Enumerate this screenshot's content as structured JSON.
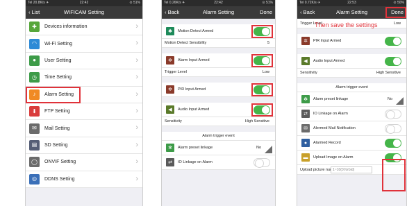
{
  "colors": {
    "accent": "#e0323a",
    "nav": "#3a3a3a",
    "toggle_on": "#45b549",
    "bg": "#efeff4"
  },
  "phone1": {
    "status": {
      "left": "Tel 20.8K/s ✈",
      "center": "22:42",
      "right": "⊙ 51%"
    },
    "nav": {
      "back": "List",
      "title": "WIFICAM Setting"
    },
    "items": [
      {
        "label": "Devices information",
        "icon": "puzzle-icon",
        "color": "#56a63a"
      },
      {
        "label": "Wi-Fi Setting",
        "icon": "wifi-icon",
        "color": "#2d8ad6"
      },
      {
        "label": "User Setting",
        "icon": "user-icon",
        "color": "#3d9b48"
      },
      {
        "label": "Time Setting",
        "icon": "clock-icon",
        "color": "#3d9b48"
      },
      {
        "label": "Alarm Setting",
        "icon": "bell-icon",
        "color": "#f08a24"
      },
      {
        "label": "FTP Setting",
        "icon": "download-icon",
        "color": "#d93c3c"
      },
      {
        "label": "Mail Setting",
        "icon": "mail-icon",
        "color": "#6b6b6b"
      },
      {
        "label": "SD Setting",
        "icon": "sd-card-icon",
        "color": "#555d75"
      },
      {
        "label": "ONVIF Setting",
        "icon": "onvif-icon",
        "color": "#6b6b6b"
      },
      {
        "label": "DDNS Setting",
        "icon": "globe-icon",
        "color": "#3a6fb8"
      }
    ]
  },
  "phone2": {
    "status": {
      "left": "Tel 0.26K/s ✈",
      "center": "22:42",
      "right": "⊙ 51%"
    },
    "nav": {
      "back": "Back",
      "title": "Alarm Setting",
      "done": "Done"
    },
    "motion_label": "Motion Detect Armed",
    "motion_sens_label": "Motion Detect Sensibility",
    "motion_sens_value": "5",
    "alarm_input_label": "Alarm Input Armed",
    "trigger_level_label": "Trigger Level",
    "trigger_level_value": "Low",
    "pir_label": "PIR Input Armed",
    "audio_label": "Audio Input Armed",
    "sensitivity_label": "Sensitivity",
    "sensitivity_value": "High Sensitive",
    "event_header": "Alarm trigger event",
    "preset_label": "Alarm preset linkage",
    "preset_value": "No",
    "io_label": "IO Linkage on Alarm"
  },
  "phone3": {
    "status": {
      "left": "Tel 0.72K/s ✈",
      "center": "22:53",
      "right": "⊙ 50%"
    },
    "nav": {
      "back": "Back",
      "title": "Alarm Setting",
      "done": "Done"
    },
    "annotation": "Then save the settings",
    "trigger_level_label": "Trigger Level",
    "trigger_level_value": "Low",
    "pir_label": "PIR Input Armed",
    "audio_label": "Audio Input Armed",
    "sensitivity_label": "Sensitivity",
    "sensitivity_value": "High Sensitive",
    "event_header": "Alarm trigger event",
    "preset_label": "Alarm preset linkage",
    "preset_value": "No",
    "io_label": "IO Linkage on Alarm",
    "mail_label": "Alermed Mail Notification",
    "record_label": "Alarmed Record",
    "upload_label": "Upload Image on Alarm",
    "upload_num_label": "Upload picture number",
    "upload_num_placeholder": "1~10(0:forbid)"
  }
}
